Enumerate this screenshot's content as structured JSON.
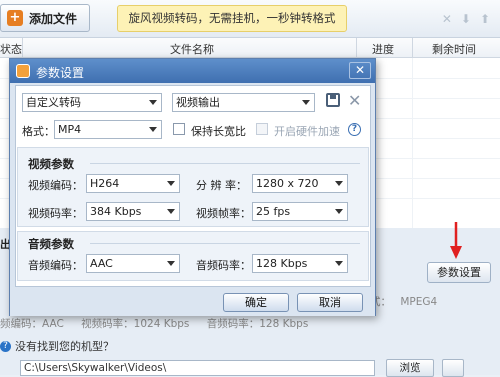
{
  "toolbar": {
    "add_file_label": "添加文件",
    "banner_text": "旋风视频转码，无需挂机，一秒钟转格式"
  },
  "list": {
    "columns": [
      "状态",
      "文件名称",
      "进度",
      "剩余时间"
    ]
  },
  "output": {
    "label": "出",
    "param_button": "参数设置",
    "format_label": "式：",
    "format_value": "MPEG4",
    "audio_info": "频编码：AAC",
    "video_bitrate_info": "视频码率：1024 Kbps",
    "audio_bitrate_info": "音频码率：128 Kbps",
    "no_model_text": "没有找到您的机型？",
    "path_value": "C:\\Users\\Skywalker\\Videos\\",
    "browse_label": "浏览"
  },
  "dialog": {
    "title": "参数设置",
    "close_glyph": "✕",
    "preset_value": "自定义转码",
    "output_type_value": "视频输出",
    "format_label": "格式：",
    "format_value": "MP4",
    "keep_ratio_label": "保持长宽比",
    "hw_accel_label": "开启硬件加速",
    "video_group_title": "视频参数",
    "video_codec_label": "视频编码：",
    "video_codec_value": "H264",
    "resolution_label": "分 辨 率：",
    "resolution_value": "1280 x 720",
    "video_bitrate_label": "视频码率：",
    "video_bitrate_value": "384 Kbps",
    "framerate_label": "视频帧率：",
    "framerate_value": "25 fps",
    "audio_group_title": "音频参数",
    "audio_codec_label": "音频编码：",
    "audio_codec_value": "AAC",
    "audio_bitrate_label": "音频码率：",
    "audio_bitrate_value": "128 Kbps",
    "ok_label": "确定",
    "cancel_label": "取消"
  },
  "colors": {
    "title_bar": "#4a7bbd",
    "banner": "#fdf2b6",
    "arrow": "#e02020"
  }
}
